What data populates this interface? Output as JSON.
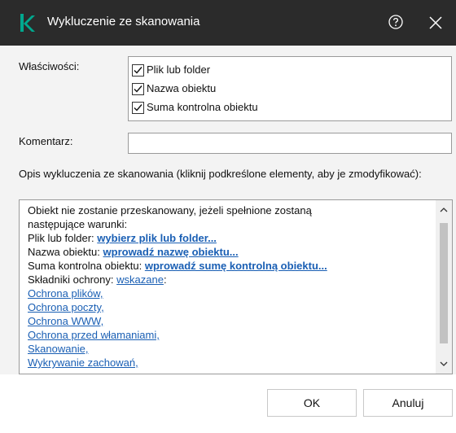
{
  "window": {
    "title": "Wykluczenie ze skanowania"
  },
  "properties": {
    "label": "Właściwości:",
    "options": [
      {
        "label": "Plik lub folder",
        "checked": true
      },
      {
        "label": "Nazwa obiektu",
        "checked": true
      },
      {
        "label": "Suma kontrolna obiektu",
        "checked": true
      }
    ]
  },
  "comment": {
    "label": "Komentarz:",
    "value": ""
  },
  "description": {
    "label": "Opis wykluczenia ze skanowania (kliknij podkreślone elementy, aby je zmodyfikować):",
    "intro_1": "Obiekt nie zostanie przeskanowany, jeżeli spełnione zostaną",
    "intro_2": "następujące warunki:",
    "file_prefix": "Plik lub folder:",
    "file_link": "wybierz plik lub folder...",
    "name_prefix": "Nazwa obiektu:",
    "name_link": "wprowadź nazwę obiektu...",
    "checksum_prefix": "Suma kontrolna obiektu:",
    "checksum_link": "wprowadź sumę kontrolną obiektu...",
    "components_prefix": "Składniki ochrony:",
    "components_link": "wskazane",
    "components_suffix": ":",
    "components": [
      "Ochrona plików,",
      "Ochrona poczty,",
      "Ochrona WWW,",
      "Ochrona przed włamaniami,",
      "Skanowanie,",
      "Wykrywanie zachowań,"
    ]
  },
  "buttons": {
    "ok": "OK",
    "cancel": "Anuluj"
  },
  "colors": {
    "titlebar": "#2b2b2b",
    "logo": "#00a88e",
    "link": "#1a5fb4",
    "body": "#f3f3f3"
  },
  "icons": {
    "logo": "kaspersky-k-icon",
    "help": "help-icon",
    "close": "close-icon"
  }
}
